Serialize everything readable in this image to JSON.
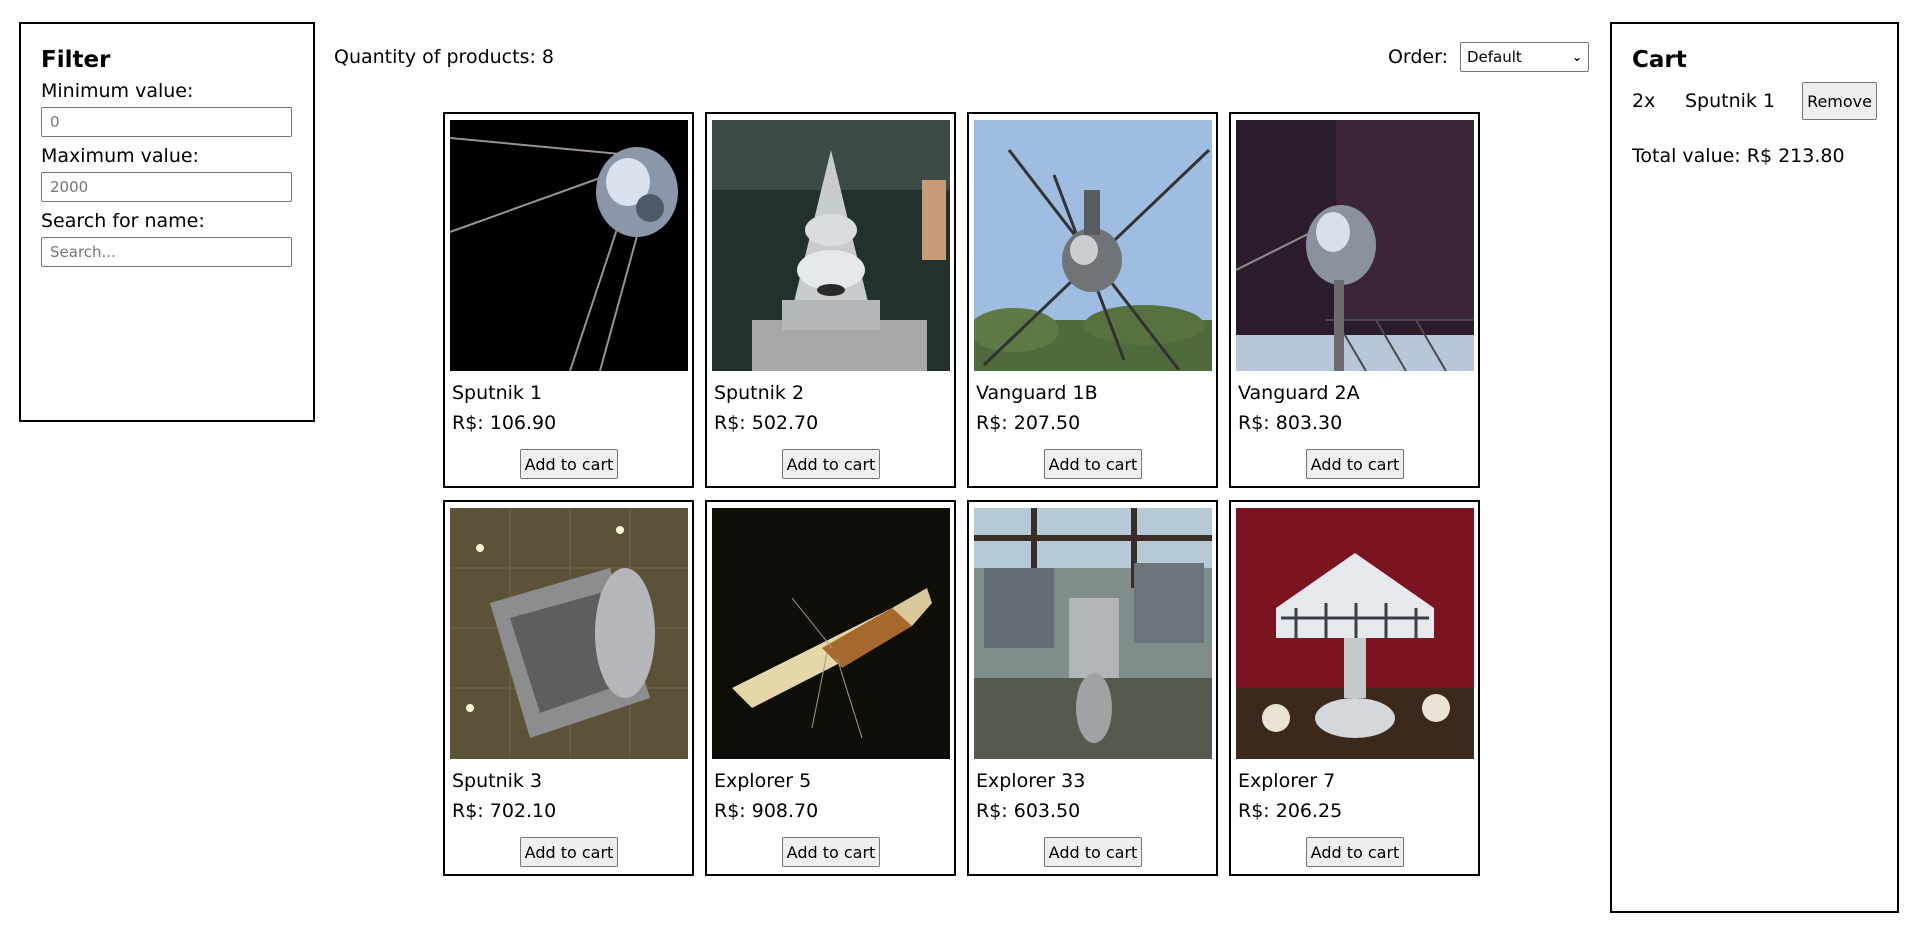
{
  "filter": {
    "title": "Filter",
    "min_label": "Minimum value:",
    "min_value": "0",
    "max_label": "Maximum value:",
    "max_value": "2000",
    "search_label": "Search for name:",
    "search_placeholder": "Search..."
  },
  "toolbar": {
    "quantity_text": "Quantity of products: 8",
    "order_label": "Order:",
    "order_selected": "Default"
  },
  "products": [
    {
      "name": "Sputnik 1",
      "price": "R$: 106.90",
      "button": "Add to cart"
    },
    {
      "name": "Sputnik 2",
      "price": "R$: 502.70",
      "button": "Add to cart"
    },
    {
      "name": "Vanguard 1B",
      "price": "R$: 207.50",
      "button": "Add to cart"
    },
    {
      "name": "Vanguard 2A",
      "price": "R$: 803.30",
      "button": "Add to cart"
    },
    {
      "name": "Sputnik 3",
      "price": "R$: 702.10",
      "button": "Add to cart"
    },
    {
      "name": "Explorer 5",
      "price": "R$: 908.70",
      "button": "Add to cart"
    },
    {
      "name": "Explorer 33",
      "price": "R$: 603.50",
      "button": "Add to cart"
    },
    {
      "name": "Explorer 7",
      "price": "R$: 206.25",
      "button": "Add to cart"
    }
  ],
  "cart": {
    "title": "Cart",
    "items": [
      {
        "qty": "2x",
        "name": "Sputnik 1",
        "remove": "Remove"
      }
    ],
    "total": "Total value: R$ 213.80"
  }
}
